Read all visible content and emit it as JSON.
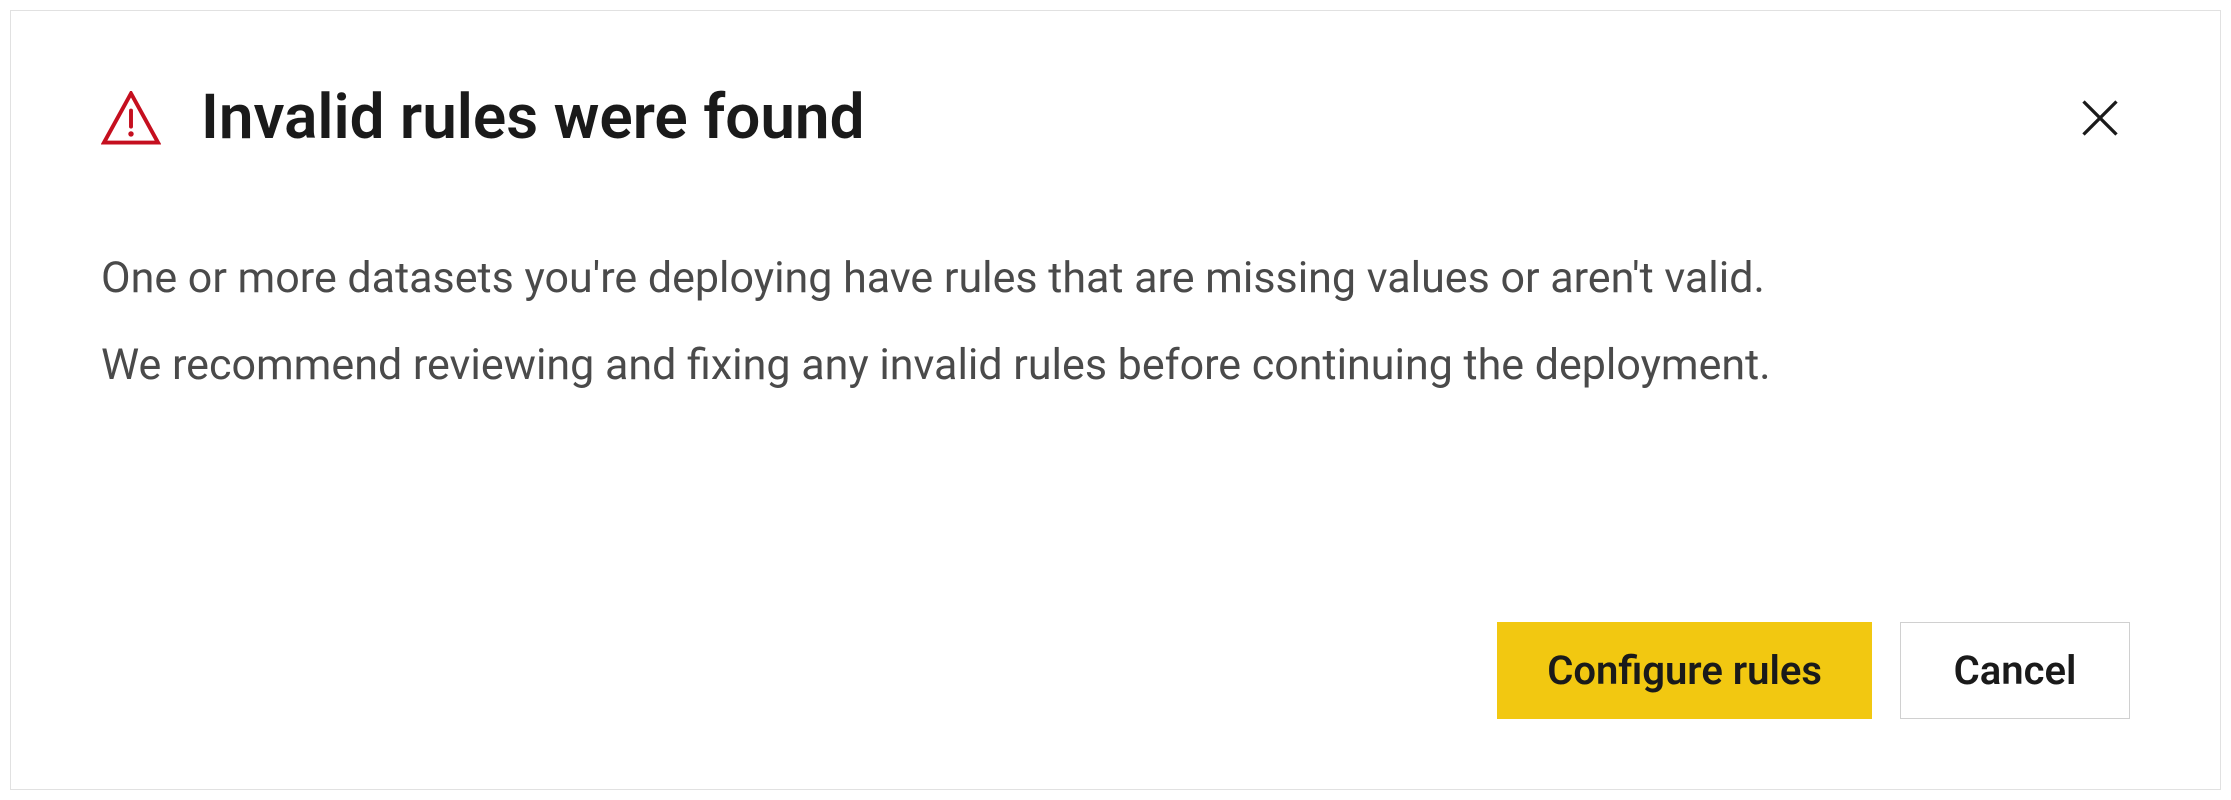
{
  "dialog": {
    "title": "Invalid rules were found",
    "body_line1": "One or more datasets you're deploying have rules that are missing values or aren't valid.",
    "body_line2": "We recommend reviewing and fixing any invalid rules before continuing the deployment.",
    "configure_label": "Configure rules",
    "cancel_label": "Cancel",
    "warning_icon": "warning-triangle",
    "close_icon": "close-x",
    "colors": {
      "warning": "#c50f1f",
      "primary": "#f2c811",
      "text": "#1a1a1a",
      "body_text": "#4a4a4a"
    }
  }
}
